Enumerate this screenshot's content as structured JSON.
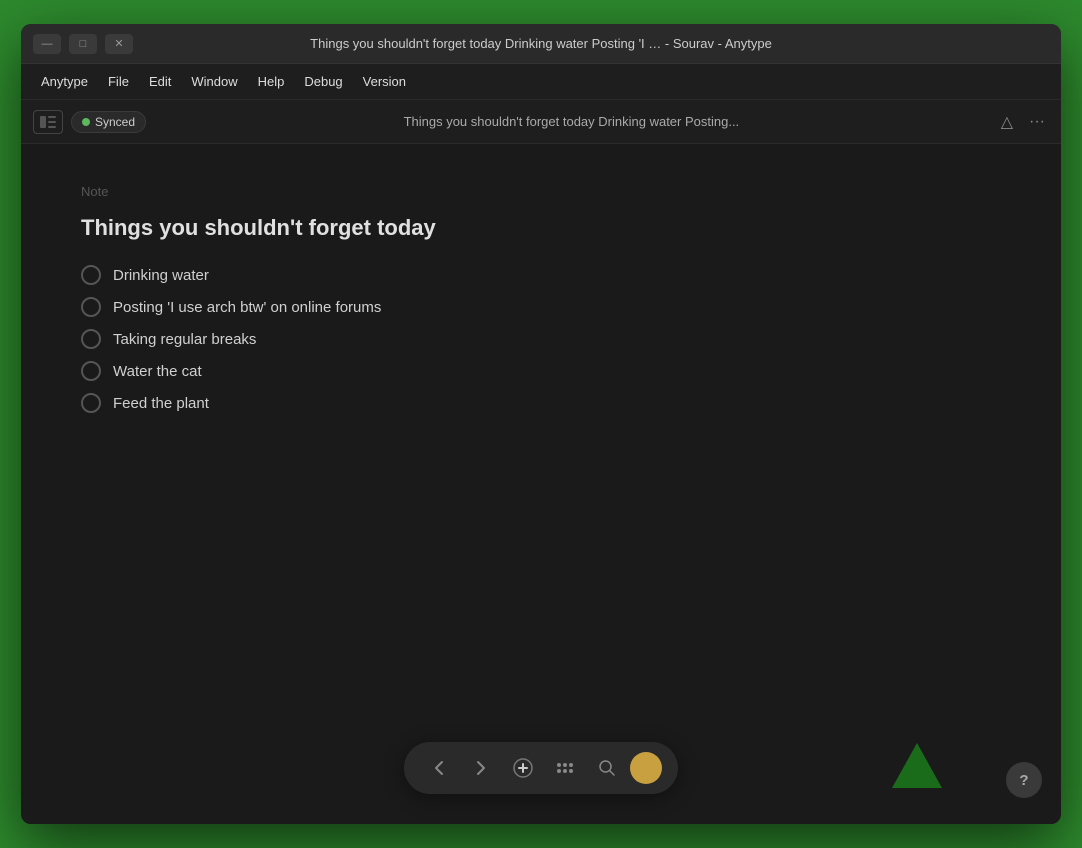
{
  "window": {
    "title": "Things you shouldn't forget today Drinking water Posting 'I … - Sourav - Anytype",
    "controls": {
      "minimize": "—",
      "maximize": "□",
      "close": "✕"
    }
  },
  "menubar": {
    "items": [
      "Anytype",
      "File",
      "Edit",
      "Window",
      "Help",
      "Debug",
      "Version"
    ]
  },
  "toolbar": {
    "sync_label": "Synced",
    "page_title": "Things you shouldn't forget today Drinking water Posting...",
    "alert_icon": "△",
    "more_icon": "···"
  },
  "note": {
    "label": "Note",
    "title": "Things you shouldn't forget today",
    "checklist": [
      {
        "id": 1,
        "text": "Drinking water",
        "checked": false
      },
      {
        "id": 2,
        "text": "Posting 'I use arch btw' on online forums",
        "checked": false
      },
      {
        "id": 3,
        "text": "Taking regular breaks",
        "checked": false
      },
      {
        "id": 4,
        "text": "Water the cat",
        "checked": false
      },
      {
        "id": 5,
        "text": "Feed the plant",
        "checked": false
      }
    ]
  },
  "bottom_nav": {
    "back_label": "‹",
    "forward_label": "›",
    "add_label": "+",
    "help_label": "?"
  }
}
